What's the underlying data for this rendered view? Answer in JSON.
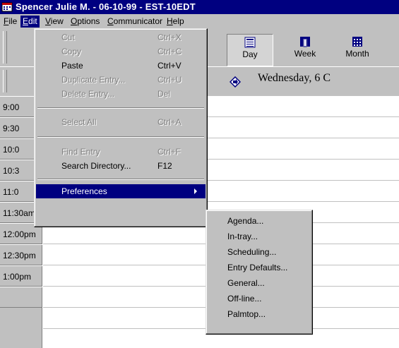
{
  "window": {
    "title": "Spencer Julie M. - 06-10-99 - EST-10EDT"
  },
  "menubar": [
    {
      "label": "File",
      "u": "F",
      "rest": "ile",
      "active": false
    },
    {
      "label": "Edit",
      "u": "E",
      "rest": "dit",
      "active": true
    },
    {
      "label": "View",
      "u": "V",
      "rest": "iew",
      "active": false
    },
    {
      "label": "Options",
      "u": "O",
      "rest": "ptions",
      "active": false
    },
    {
      "label": "Communicator",
      "u": "C",
      "rest": "ommunicator",
      "active": false
    },
    {
      "label": "Help",
      "u": "H",
      "rest": "elp",
      "active": false
    }
  ],
  "toolbar": {
    "day_label": "Day",
    "week_label": "Week",
    "month_label": "Month"
  },
  "date_header": "Wednesday, 6 C",
  "time_slots": [
    "9:00",
    "9:30",
    "10:0",
    "10:3",
    "11:0",
    "11:30am",
    "12:00pm",
    "12:30pm",
    "1:00pm"
  ],
  "edit_menu": {
    "items": [
      {
        "label": "Cut",
        "shortcut": "Ctrl+X",
        "enabled": false
      },
      {
        "label": "Copy",
        "shortcut": "Ctrl+C",
        "enabled": false
      },
      {
        "label": "Paste",
        "shortcut": "Ctrl+V",
        "enabled": true
      },
      {
        "label": "Duplicate Entry...",
        "shortcut": "Ctrl+U",
        "enabled": false
      },
      {
        "label": "Delete Entry...",
        "shortcut": "Del",
        "enabled": false
      },
      {
        "label": "Select All",
        "shortcut": "Ctrl+A",
        "enabled": false
      },
      {
        "label": "Find Entry",
        "shortcut": "Ctrl+F",
        "enabled": false
      },
      {
        "label": "Search Directory...",
        "shortcut": "F12",
        "enabled": true
      },
      {
        "label": "Preferences",
        "shortcut": "",
        "enabled": true,
        "selected": true
      }
    ]
  },
  "preferences_submenu": {
    "items": [
      "Agenda...",
      "In-tray...",
      "Scheduling...",
      "Entry Defaults...",
      "General...",
      "Off-line...",
      "Palmtop..."
    ]
  },
  "colors": {
    "titlebar": "#000080",
    "face": "#c0c0c0",
    "highlight": "#000080"
  }
}
